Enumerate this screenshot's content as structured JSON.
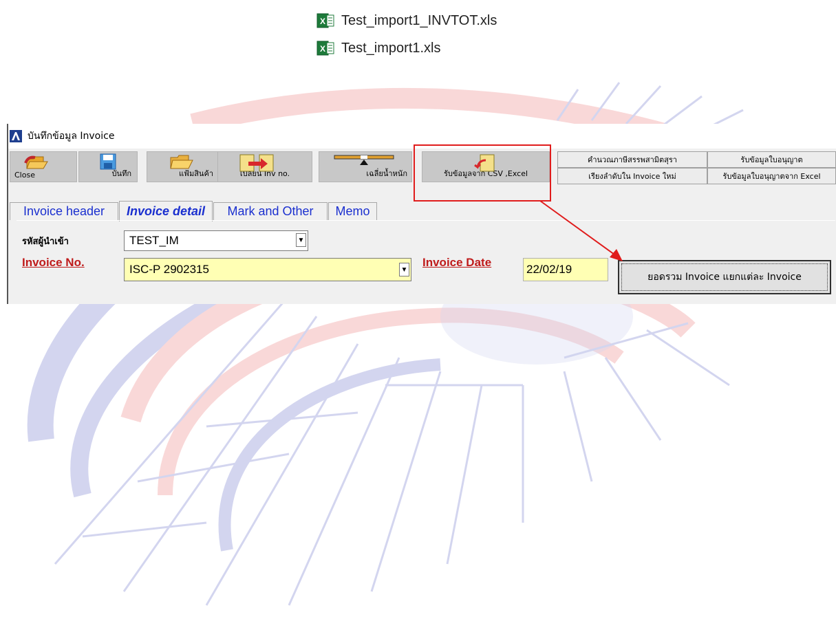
{
  "files": [
    {
      "name": "Test_import1_INVTOT.xls",
      "icon": "excel-file-icon"
    },
    {
      "name": "Test_import1.xls",
      "icon": "excel-file-icon"
    }
  ],
  "window": {
    "title": "บันทึกข้อมูล Invoice"
  },
  "toolbar": {
    "close": "Close",
    "save": "บันทึก",
    "product_file": "แฟ้มสินค้า",
    "change_inv": "เปลี่ยน Inv no.",
    "avg_weight": "เฉลี่ยน้ำหนัก",
    "import_csv": "รับข้อมูลจาก CSV ,Excel",
    "calc_tax": "คำนวณภาษีสรรพสามิตสุรา",
    "reorder": "เรียงลำดับใน Invoice ใหม่",
    "receive_license": "รับข้อมูลใบอนุญาต",
    "license_excel": "รับข้อมูลใบอนุญาตจาก Excel"
  },
  "tabs": [
    {
      "label": "Invoice header",
      "active": false
    },
    {
      "label": "Invoice detail",
      "active": true
    },
    {
      "label": "Mark and Other",
      "active": false
    },
    {
      "label": "Memo",
      "active": false
    }
  ],
  "form": {
    "importer_label": "รหัสผู้นำเข้า",
    "importer_value": "TEST_IM",
    "invoice_no_label": "Invoice No.",
    "invoice_no_value": "ISC-P 2902315",
    "invoice_date_label": "Invoice Date",
    "invoice_date_value": "22/02/19",
    "summary_button": "ยอดรวม Invoice แยกแต่ละ Invoice"
  },
  "colors": {
    "label_red": "#bf1b1b",
    "tab_blue": "#1a2fcf",
    "date_bg": "#ffffb4",
    "annotation_red": "#e01c1c"
  }
}
